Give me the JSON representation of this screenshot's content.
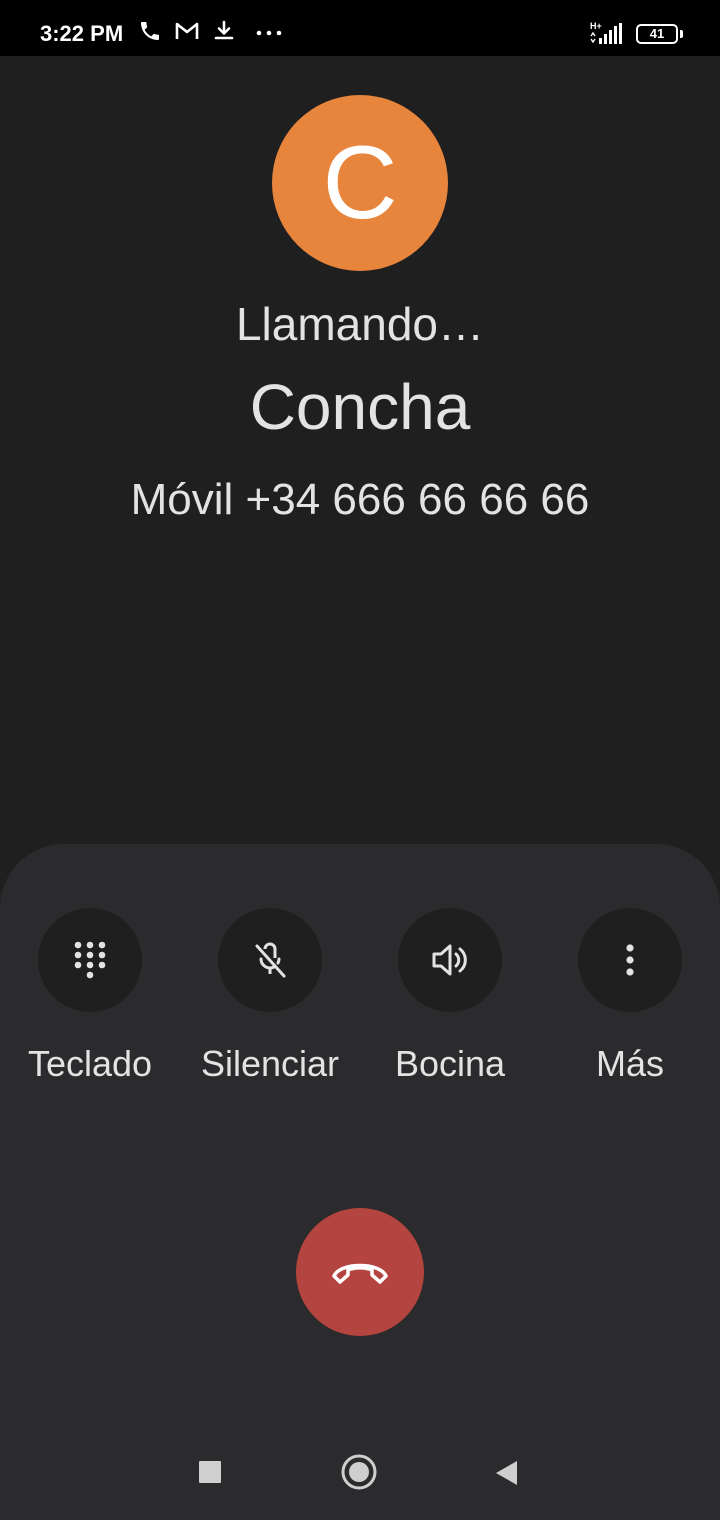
{
  "status_bar": {
    "time": "3:22 PM",
    "network_type": "H+",
    "battery_level": "41",
    "icons": [
      "phone-icon",
      "gmail-icon",
      "download-icon",
      "more-dots-icon",
      "signal-icon",
      "battery-icon"
    ]
  },
  "contact": {
    "avatar_letter": "C",
    "avatar_color": "#e8853d",
    "call_status": "Llamando…",
    "name": "Concha",
    "number": "Móvil +34 666 66 66 66"
  },
  "controls": [
    {
      "label": "Teclado",
      "icon": "dialpad-icon"
    },
    {
      "label": "Silenciar",
      "icon": "mic-off-icon"
    },
    {
      "label": "Bocina",
      "icon": "speaker-icon"
    },
    {
      "label": "Más",
      "icon": "more-vert-icon"
    }
  ],
  "end_call": {
    "icon": "end-call-icon",
    "color": "#b3443f"
  },
  "nav_bar": {
    "icons": [
      "recents-square-icon",
      "home-circle-icon",
      "back-triangle-icon"
    ]
  }
}
